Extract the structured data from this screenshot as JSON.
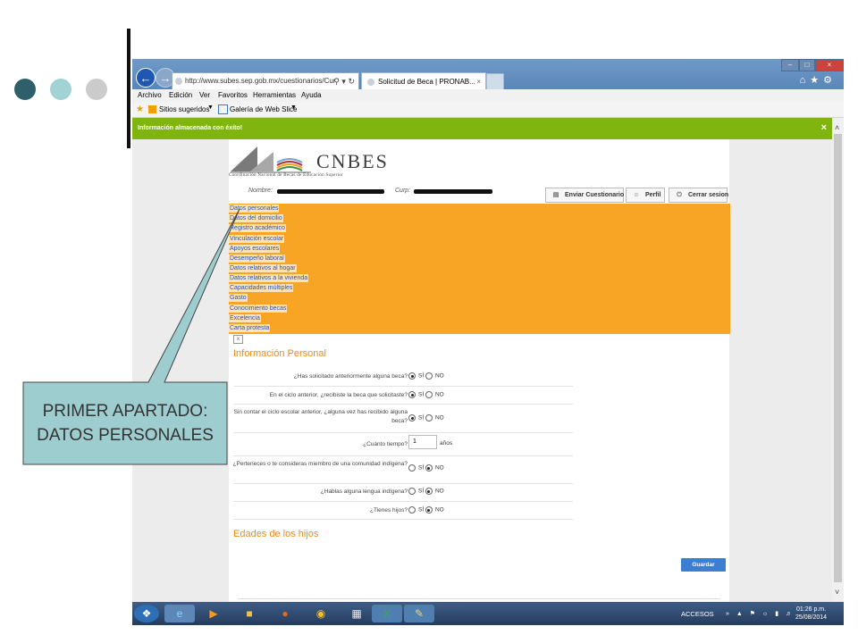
{
  "colors": {
    "dot1": "#2f5f6a",
    "dot2": "#a2d2d4",
    "dot3": "#cbcbcb",
    "accent_green": "#80b40e",
    "accent_orange": "#f8a525",
    "callout": "#9ecdcf",
    "link": "#2553b8",
    "heading": "#f08a14",
    "button": "#3a7fd1"
  },
  "browser": {
    "url": "http://www.subes.sep.gob.mx/cuestionarios/Cur",
    "tab_title": "Solicitud de Beca | PRONAB...",
    "menu": [
      "Archivo",
      "Edición",
      "Ver",
      "Favoritos",
      "Herramientas",
      "Ayuda"
    ],
    "favorites": [
      "Sitios sugeridos",
      "Galería de Web Slice"
    ]
  },
  "notice": {
    "text": "Información almacenada con éxito!",
    "close": "×"
  },
  "header": {
    "logo_title": "CNBES",
    "logo_subtitle": "Coordinación Nacional de Becas de Educación Superior",
    "nombre_label": "Nombre:",
    "curp_label": "Curp:",
    "buttons": {
      "enviar": "Enviar Cuestionario",
      "perfil": "Perfil",
      "cerrar": "Cerrar sesion"
    }
  },
  "nav": [
    "Datos personales",
    "Datos del domicilio",
    "Registro académico",
    "Vinculación escolar",
    "Apoyos escolares",
    "Desempeño laboral",
    "Datos relativos al hogar",
    "Datos relativos a la vivienda",
    "Capacidades múltiples",
    "Gasto",
    "Conocimiento becas",
    "Excelencia",
    "Carta protesta"
  ],
  "section_title": "Información Personal",
  "questions": [
    {
      "text": "¿Has solicitado anteriormente alguna beca?",
      "selected": "si"
    },
    {
      "text": "En el ciclo anterior, ¿recibiste la beca que solicitaste?",
      "selected": "si"
    },
    {
      "text": "Sin contar el ciclo escolar anterior, ¿alguna vez has recibido alguna beca?",
      "selected": "si"
    },
    {
      "text": "¿Cuánto tiempo?",
      "value": "1",
      "unit": "años"
    },
    {
      "text": "¿Perteneces o te consideras miembro de una comunidad indígena?",
      "selected": "no"
    },
    {
      "text": "¿Hablas alguna lengua indígena?",
      "selected": "no"
    },
    {
      "text": "¿Tienes hijos?",
      "selected": "no"
    }
  ],
  "options": {
    "si": "SÍ",
    "no": "NO"
  },
  "section2_title": "Edades de los hijos",
  "save_label": "Guardar",
  "taskbar": {
    "accesos": "ACCESOS",
    "time": "01:26 p.m.",
    "date": "25/08/2014"
  },
  "callout": "PRIMER APARTADO: DATOS PERSONALES"
}
